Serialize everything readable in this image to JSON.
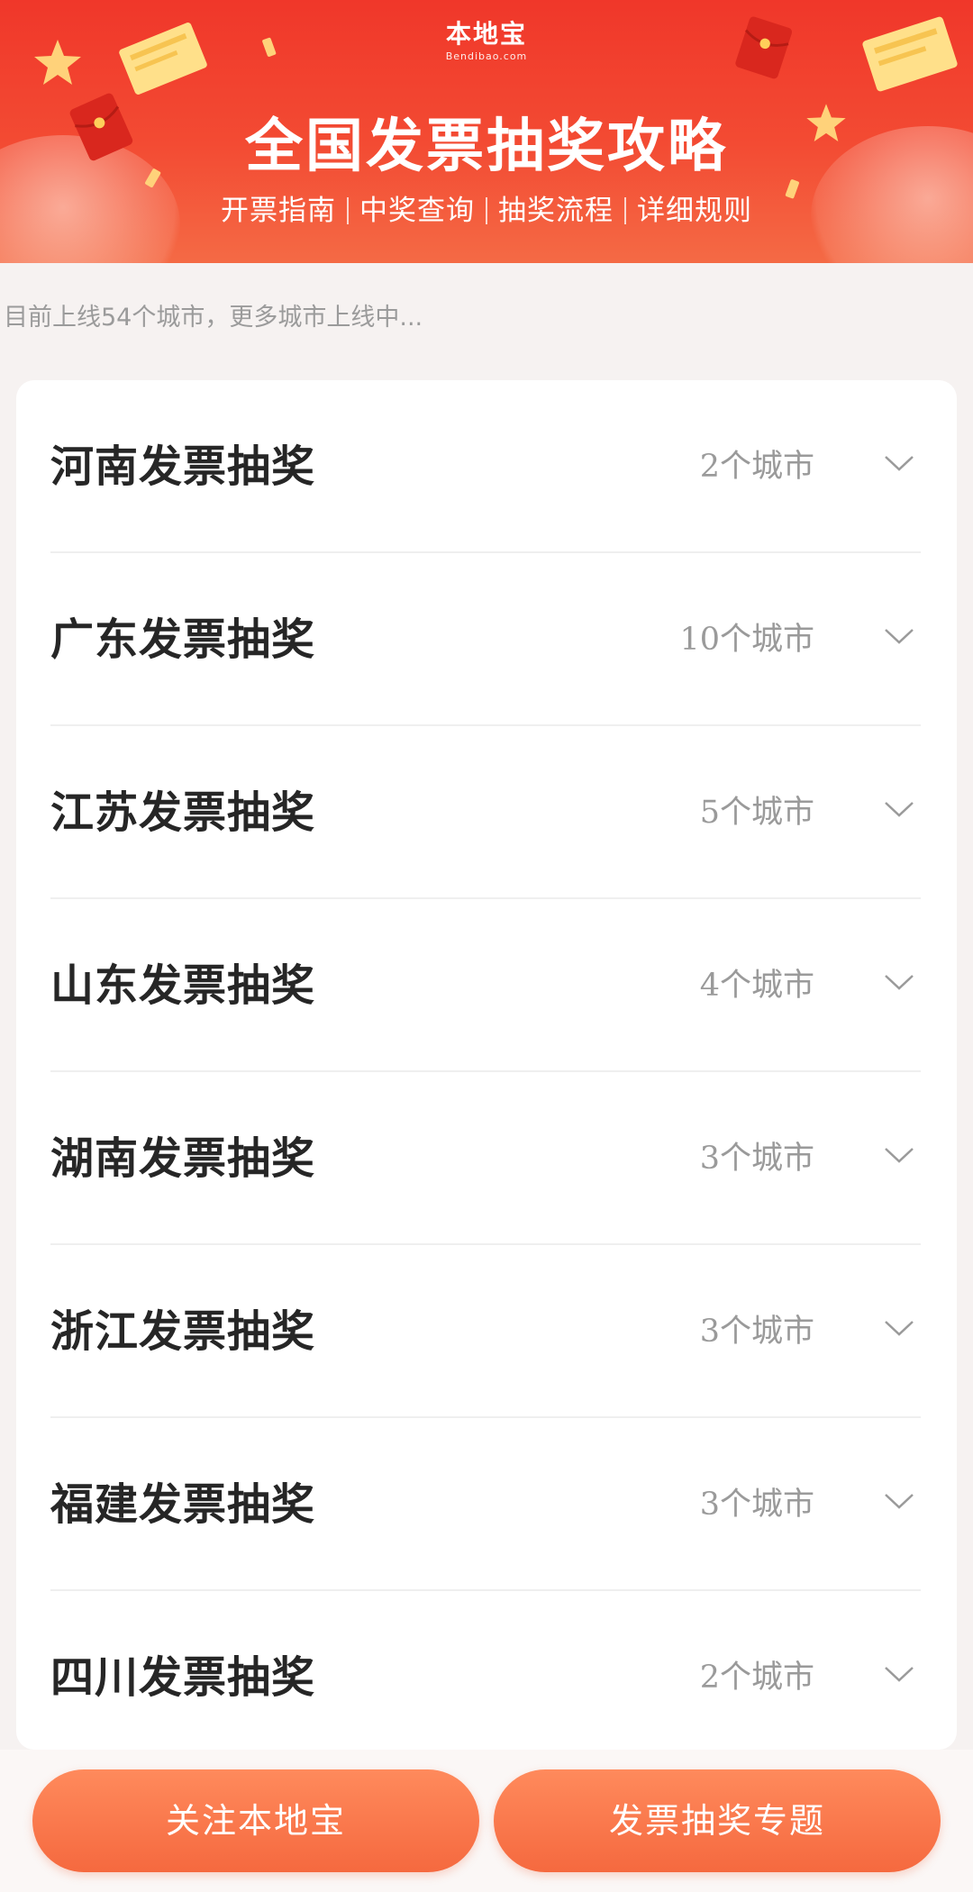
{
  "banner": {
    "logo_text": "本地宝",
    "logo_sub": "Bendibao.com",
    "title": "全国发票抽奖攻略",
    "nav": [
      {
        "label": "开票指南"
      },
      {
        "label": "中奖查询"
      },
      {
        "label": "抽奖流程"
      },
      {
        "label": "详细规则"
      }
    ],
    "colors": {
      "primary": "#f0372a",
      "secondary": "#f46a45"
    }
  },
  "notice": "目前上线54个城市，更多城市上线中...",
  "provinces": [
    {
      "name": "河南发票抽奖",
      "count": "2个城市"
    },
    {
      "name": "广东发票抽奖",
      "count": "10个城市"
    },
    {
      "name": "江苏发票抽奖",
      "count": "5个城市"
    },
    {
      "name": "山东发票抽奖",
      "count": "4个城市"
    },
    {
      "name": "湖南发票抽奖",
      "count": "3个城市"
    },
    {
      "name": "浙江发票抽奖",
      "count": "3个城市"
    },
    {
      "name": "福建发票抽奖",
      "count": "3个城市"
    },
    {
      "name": "四川发票抽奖",
      "count": "2个城市"
    }
  ],
  "bottom_bar": {
    "follow_label": "关注本地宝",
    "topic_label": "发票抽奖专题",
    "button_color": "#f5693f"
  }
}
